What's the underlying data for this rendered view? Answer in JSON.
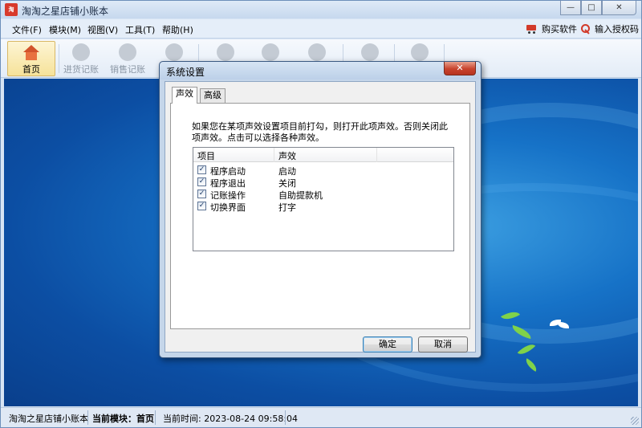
{
  "window": {
    "title": "淘淘之星店铺小账本",
    "logo_text": "淘",
    "controls": {
      "minimize": "—",
      "maximize": "□",
      "close": "✕"
    }
  },
  "menubar": {
    "items": [
      "文件(F)",
      "模块(M)",
      "视图(V)",
      "工具(T)",
      "帮助(H)"
    ],
    "buy_label": "购买软件",
    "license_label": "输入授权码"
  },
  "toolbar": {
    "items": [
      {
        "label": "首页",
        "icon": "home-icon",
        "active": true
      },
      {
        "label": "进货记账",
        "icon": "purchase-icon",
        "active": false
      },
      {
        "label": "销售记账",
        "icon": "sales-icon",
        "active": false
      }
    ]
  },
  "dialog": {
    "title": "系统设置",
    "close": "✕",
    "tabs": [
      {
        "label": "声效",
        "active": true
      },
      {
        "label": "高级",
        "active": false
      }
    ],
    "description": "如果您在某项声效设置项目前打勾，则打开此项声效。否则关闭此项声效。点击可以选择各种声效。",
    "list": {
      "columns": [
        "项目",
        "声效"
      ],
      "rows": [
        {
          "checked": true,
          "name": "程序启动",
          "sound": "启动"
        },
        {
          "checked": true,
          "name": "程序退出",
          "sound": "关闭"
        },
        {
          "checked": true,
          "name": "记账操作",
          "sound": "自助提款机"
        },
        {
          "checked": true,
          "name": "切换界面",
          "sound": "打字"
        }
      ]
    },
    "ok_label": "确定",
    "cancel_label": "取消"
  },
  "statusbar": {
    "app_name": "淘淘之星店铺小账本",
    "module": "当前模块：首页",
    "time": "当前时间: 2023-08-24 09:58:04"
  },
  "colors": {
    "accent": "#d23a2a",
    "desktop": "#1672c7",
    "dialog_frame": "#c5d6ea"
  }
}
